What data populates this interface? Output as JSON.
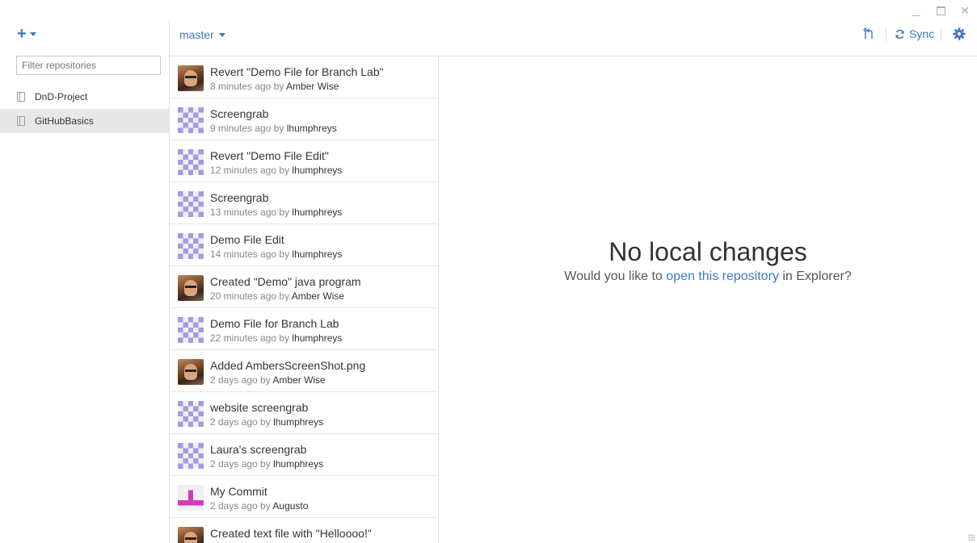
{
  "sidebar": {
    "filter_placeholder": "Filter repositories",
    "repos": [
      {
        "label": "DnD-Project",
        "selected": false
      },
      {
        "label": "GitHubBasics",
        "selected": true
      }
    ]
  },
  "header": {
    "branch": "master",
    "sync_label": "Sync"
  },
  "commits": [
    {
      "title": "Revert \"Demo File for Branch Lab\"",
      "time": "8 minutes ago by",
      "author": "Amber Wise",
      "avatar": "photo"
    },
    {
      "title": "Screengrab",
      "time": "9 minutes ago by",
      "author": "lhumphreys",
      "avatar": "identicon-purple"
    },
    {
      "title": "Revert \"Demo File Edit\"",
      "time": "12 minutes ago by",
      "author": "lhumphreys",
      "avatar": "identicon-purple"
    },
    {
      "title": "Screengrab",
      "time": "13 minutes ago by",
      "author": "lhumphreys",
      "avatar": "identicon-purple"
    },
    {
      "title": "Demo File Edit",
      "time": "14 minutes ago by",
      "author": "lhumphreys",
      "avatar": "identicon-purple"
    },
    {
      "title": "Created \"Demo\" java program",
      "time": "20 minutes ago by",
      "author": "Amber Wise",
      "avatar": "photo"
    },
    {
      "title": "Demo File for Branch Lab",
      "time": "22 minutes ago by",
      "author": "lhumphreys",
      "avatar": "identicon-purple"
    },
    {
      "title": "Added AmbersScreenShot.png",
      "time": "2 days ago by",
      "author": "Amber Wise",
      "avatar": "photo"
    },
    {
      "title": "website screengrab",
      "time": "2 days ago by",
      "author": "lhumphreys",
      "avatar": "identicon-purple"
    },
    {
      "title": "Laura's screengrab",
      "time": "2 days ago by",
      "author": "lhumphreys",
      "avatar": "identicon-purple"
    },
    {
      "title": "My Commit",
      "time": "2 days ago by",
      "author": "Augusto",
      "avatar": "identicon-magenta"
    },
    {
      "title": "Created text file with \"Helloooo!\"",
      "time": "",
      "author": "",
      "avatar": "photo"
    }
  ],
  "empty_state": {
    "title": "No local changes",
    "prefix": "Would you like to",
    "link": "open this repository",
    "suffix": "in Explorer?"
  },
  "colors": {
    "accent": "#4078c0",
    "identicon_purple": "#a59ae6",
    "identicon_magenta": "#d23cb8"
  }
}
